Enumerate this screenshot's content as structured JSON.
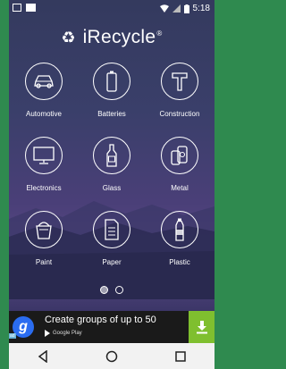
{
  "status_bar": {
    "time": "5:18",
    "icons": [
      "image-icon",
      "gmail-icon",
      "wifi-icon",
      "signal-icon",
      "battery-icon"
    ]
  },
  "header": {
    "app_name": "iRecycle",
    "trademark": "®",
    "logo_icon": "recycle-icon"
  },
  "categories": [
    {
      "label": "Automotive",
      "icon": "car-icon"
    },
    {
      "label": "Batteries",
      "icon": "battery-icon"
    },
    {
      "label": "Construction",
      "icon": "hammer-icon"
    },
    {
      "label": "Electronics",
      "icon": "monitor-icon"
    },
    {
      "label": "Glass",
      "icon": "bottle-icon"
    },
    {
      "label": "Metal",
      "icon": "can-icon"
    },
    {
      "label": "Paint",
      "icon": "paint-bucket-icon"
    },
    {
      "label": "Paper",
      "icon": "document-icon"
    },
    {
      "label": "Plastic",
      "icon": "plastic-bottle-icon"
    }
  ],
  "pager": {
    "pages": 2,
    "current": 1
  },
  "ad": {
    "headline": "Create groups of up to 50",
    "store": "Google Play",
    "badge_letter": "g",
    "ad_tag": "ad"
  },
  "nav": [
    "back-icon",
    "home-icon",
    "recents-icon"
  ],
  "colors": {
    "frame": "#2f8a4f",
    "background_top": "#343a5e",
    "background_mid": "#5a4a86",
    "download_green": "#7fbf2f",
    "ad_badge_blue": "#2a6cf0"
  }
}
